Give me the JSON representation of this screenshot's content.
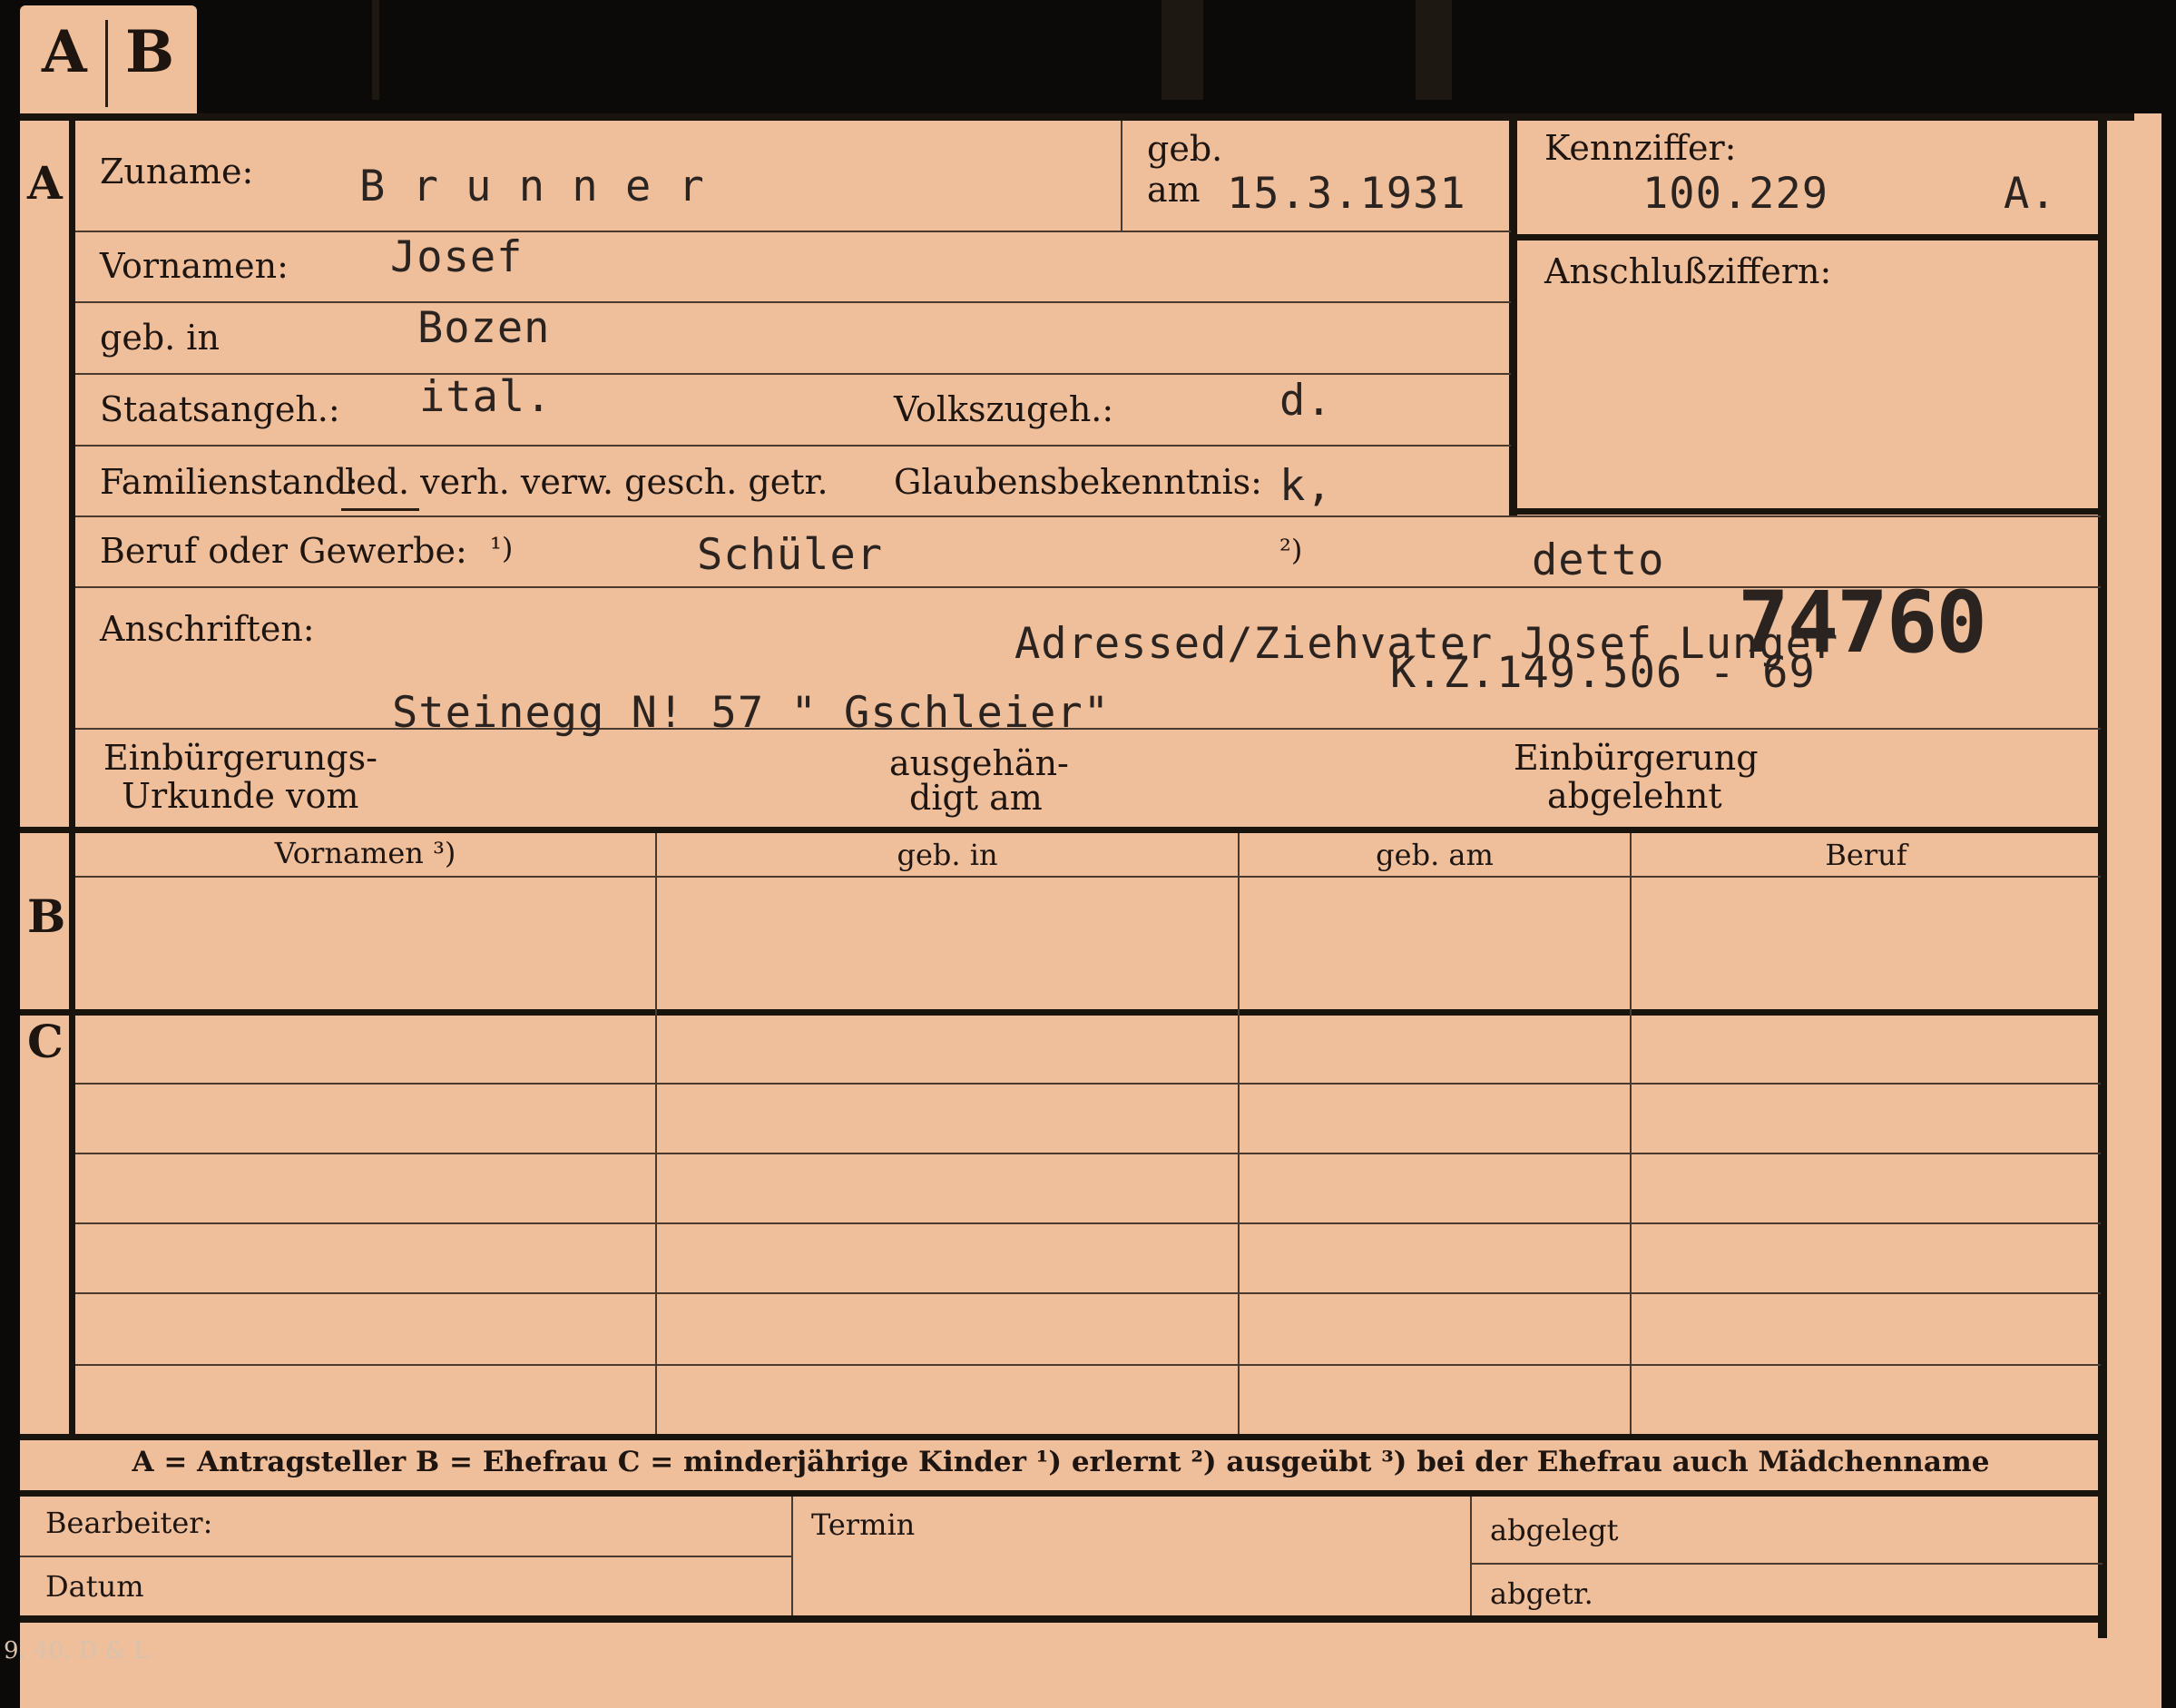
{
  "tab": {
    "letter_a": "A",
    "letter_b": "B"
  },
  "sections": {
    "a": "A",
    "b": "B",
    "c": "C"
  },
  "labels": {
    "zuname": "Zuname:",
    "geb": "geb.",
    "am": "am",
    "kennziffer": "Kennziffer:",
    "anschlussziffern": "Anschlußziffern:",
    "vornamen": "Vornamen:",
    "geb_in": "geb. in",
    "staatsangeh": "Staatsangeh.:",
    "volkszugeh": "Volkszugeh.:",
    "familienstand": "Familienstand:",
    "familienstand_options": "led. verh. verw. gesch. getr.",
    "glaubensbekenntnis": "Glaubensbekenntnis:",
    "beruf_oder_gewerbe": "Beruf oder Gewerbe:",
    "note_1": "¹)",
    "note_2": "²)",
    "anschriften": "Anschriften:",
    "einbuergerung_line1": "Einbürgerungs-",
    "einbuergerung_line2": "Urkunde vom",
    "ausgehaendigt_line1": "ausgehän-",
    "ausgehaendigt_line2": "digt am",
    "einbuergerung_abgelehnt_line1": "Einbürgerung",
    "einbuergerung_abgelehnt_line2": "abgelehnt",
    "col_vornamen": "Vornamen ³)",
    "col_geb_in": "geb. in",
    "col_geb_am": "geb. am",
    "col_beruf": "Beruf",
    "bearbeiter": "Bearbeiter:",
    "datum": "Datum",
    "termin": "Termin",
    "abgelegt": "abgelegt",
    "abgetr": "abgetr."
  },
  "values": {
    "zuname": "B r u n n e r",
    "geb_am": "15.3.1931",
    "kennziffer": "100.229",
    "kennziffer_suffix": "A.",
    "vornamen": "Josef",
    "geb_in": "Bozen",
    "staatsangeh": "ital.",
    "volkszugeh": "d.",
    "glaubensbekenntnis": "k,",
    "beruf_erlernt": "Schüler",
    "beruf_ausgeuebt": "detto",
    "address_line1": "Adressed/Ziehvater Josef Lunger",
    "kz_number": "K.Z.149.506 - 69",
    "address_line2": "Steinegg N! 57 \" Gschleier\"",
    "stamp_number": "74760"
  },
  "legend": "A = Antragsteller   B = Ehefrau   C = minderjährige Kinder   ¹) erlernt   ²) ausgeübt   ³) bei der Ehefrau auch Mädchenname",
  "print_code": "9. 40. D & L"
}
